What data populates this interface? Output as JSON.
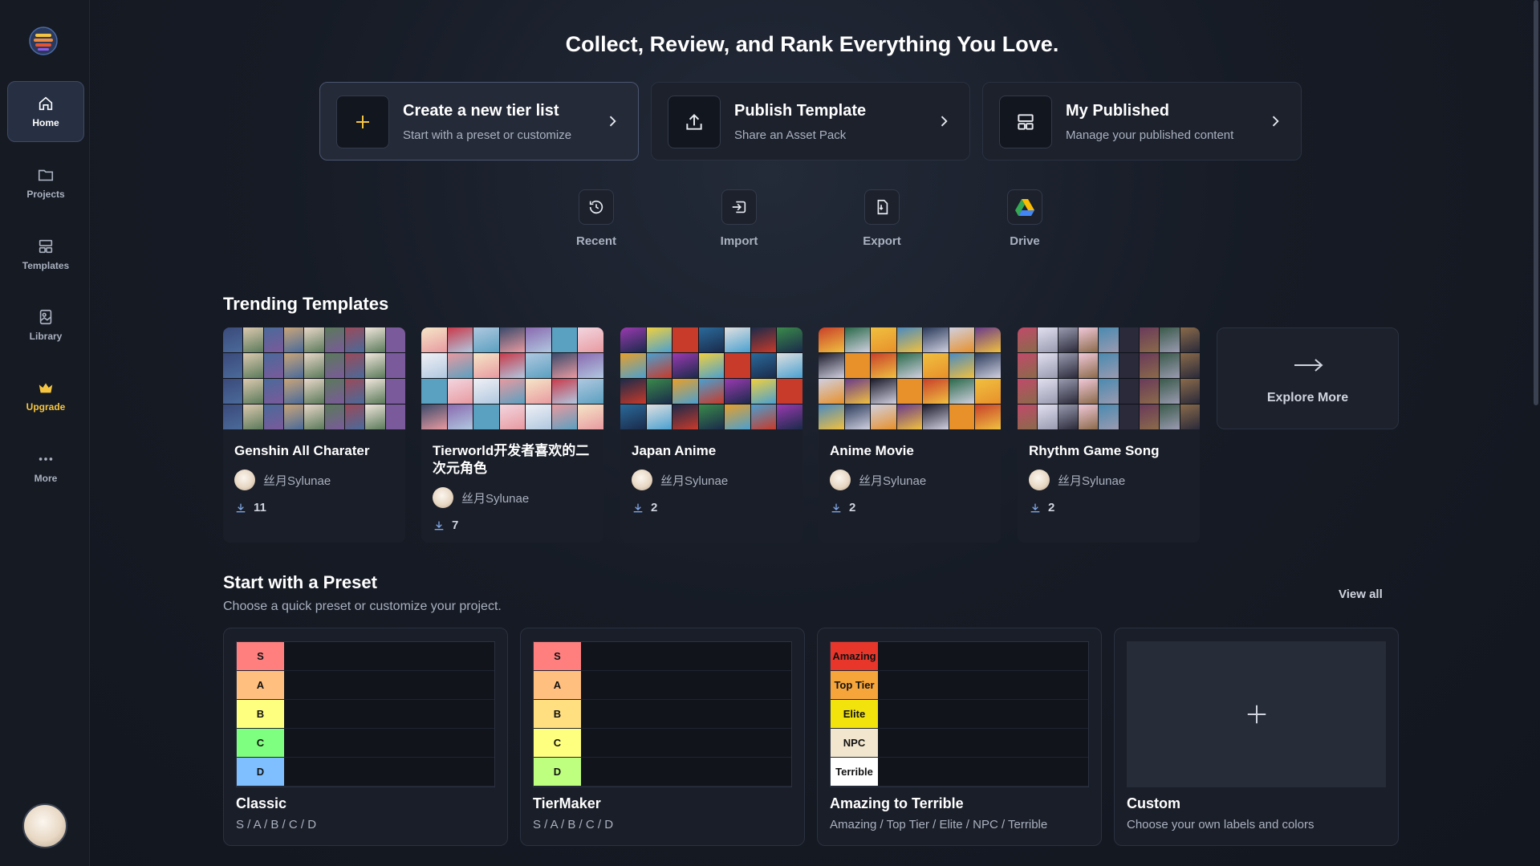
{
  "headline": "Collect, Review, and Rank Everything You Love.",
  "sidebar": {
    "items": [
      {
        "label": "Home",
        "icon": "home-icon"
      },
      {
        "label": "Projects",
        "icon": "folder-icon"
      },
      {
        "label": "Templates",
        "icon": "template-icon"
      },
      {
        "label": "Library",
        "icon": "library-icon"
      },
      {
        "label": "Upgrade",
        "icon": "crown-icon"
      },
      {
        "label": "More",
        "icon": "more-dots-icon"
      }
    ]
  },
  "actions": [
    {
      "title": "Create a new tier list",
      "subtitle": "Start with a preset or customize",
      "icon": "plus-icon"
    },
    {
      "title": "Publish Template",
      "subtitle": "Share an Asset Pack",
      "icon": "upload-icon"
    },
    {
      "title": "My Published",
      "subtitle": "Manage your published content",
      "icon": "layout-icon"
    }
  ],
  "quick_actions": [
    {
      "label": "Recent",
      "icon": "history-icon"
    },
    {
      "label": "Import",
      "icon": "import-icon"
    },
    {
      "label": "Export",
      "icon": "export-icon"
    },
    {
      "label": "Drive",
      "icon": "google-drive-icon"
    }
  ],
  "trending": {
    "title": "Trending Templates",
    "items": [
      {
        "name": "Genshin All Charater",
        "author": "丝月Sylunae",
        "downloads": "11"
      },
      {
        "name": "Tierworld开发者喜欢的二次元角色",
        "author": "丝月Sylunae",
        "downloads": "7"
      },
      {
        "name": "Japan Anime",
        "author": "丝月Sylunae",
        "downloads": "2"
      },
      {
        "name": "Anime Movie",
        "author": "丝月Sylunae",
        "downloads": "2"
      },
      {
        "name": "Rhythm Game Song",
        "author": "丝月Sylunae",
        "downloads": "2"
      }
    ],
    "explore_label": "Explore More"
  },
  "presets": {
    "title": "Start with a Preset",
    "subtitle": "Choose a quick preset or customize your project.",
    "view_all": "View all",
    "items": [
      {
        "name": "Classic",
        "description": "S / A / B / C / D",
        "tiers": [
          {
            "label": "S",
            "color": "#ff7f7f"
          },
          {
            "label": "A",
            "color": "#ffbf7f"
          },
          {
            "label": "B",
            "color": "#ffff7f"
          },
          {
            "label": "C",
            "color": "#7fff7f"
          },
          {
            "label": "D",
            "color": "#7fbfff"
          }
        ]
      },
      {
        "name": "TierMaker",
        "description": "S / A / B / C / D",
        "tiers": [
          {
            "label": "S",
            "color": "#ff7f7f"
          },
          {
            "label": "A",
            "color": "#ffbf7f"
          },
          {
            "label": "B",
            "color": "#ffdf7f"
          },
          {
            "label": "C",
            "color": "#ffff7f"
          },
          {
            "label": "D",
            "color": "#bfff7f"
          }
        ]
      },
      {
        "name": "Amazing to Terrible",
        "description": "Amazing / Top Tier / Elite / NPC / Terrible",
        "tiers": [
          {
            "label": "Amazing",
            "color": "#e8362b"
          },
          {
            "label": "Top Tier",
            "color": "#f6a53a"
          },
          {
            "label": "Elite",
            "color": "#f2e30d"
          },
          {
            "label": "NPC",
            "color": "#f2e6cf"
          },
          {
            "label": "Terrible",
            "color": "#ffffff"
          }
        ]
      },
      {
        "name": "Custom",
        "description": "Choose your own labels and colors"
      }
    ]
  }
}
